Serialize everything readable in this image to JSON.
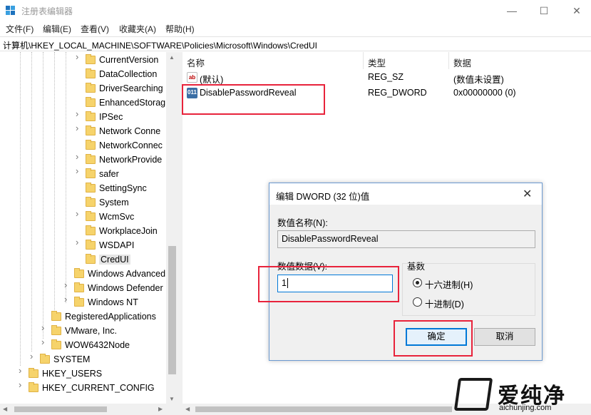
{
  "window": {
    "title": "注册表编辑器",
    "minimize": "—",
    "maximize": "☐",
    "close": "✕"
  },
  "menu": [
    "文件(F)",
    "编辑(E)",
    "查看(V)",
    "收藏夹(A)",
    "帮助(H)"
  ],
  "address": "计算机\\HKEY_LOCAL_MACHINE\\SOFTWARE\\Policies\\Microsoft\\Windows\\CredUI",
  "tree": [
    {
      "label": "CurrentVersion",
      "expandable": true
    },
    {
      "label": "DataCollection",
      "expandable": false
    },
    {
      "label": "DriverSearching",
      "expandable": false
    },
    {
      "label": "EnhancedStorag",
      "expandable": false
    },
    {
      "label": "IPSec",
      "expandable": true
    },
    {
      "label": "Network Conne",
      "expandable": true
    },
    {
      "label": "NetworkConnec",
      "expandable": false
    },
    {
      "label": "NetworkProvide",
      "expandable": true
    },
    {
      "label": "safer",
      "expandable": true
    },
    {
      "label": "SettingSync",
      "expandable": false
    },
    {
      "label": "System",
      "expandable": false
    },
    {
      "label": "WcmSvc",
      "expandable": true
    },
    {
      "label": "WorkplaceJoin",
      "expandable": false
    },
    {
      "label": "WSDAPI",
      "expandable": true
    },
    {
      "label": "CredUI",
      "expandable": false,
      "selected": true
    },
    {
      "label": "Windows Advanced",
      "expandable": false
    },
    {
      "label": "Windows Defender",
      "expandable": true
    },
    {
      "label": "Windows NT",
      "expandable": true
    },
    {
      "label": "RegisteredApplications",
      "expandable": false
    },
    {
      "label": "VMware, Inc.",
      "expandable": true
    },
    {
      "label": "WOW6432Node",
      "expandable": true
    },
    {
      "label": "SYSTEM",
      "expandable": true
    },
    {
      "label": "HKEY_USERS",
      "expandable": true
    },
    {
      "label": "HKEY_CURRENT_CONFIG",
      "expandable": true
    }
  ],
  "list": {
    "columns": [
      "名称",
      "类型",
      "数据"
    ],
    "rows": [
      {
        "icon": "ab",
        "name": "(默认)",
        "type": "REG_SZ",
        "data": "(数值未设置)"
      },
      {
        "icon": "011",
        "name": "DisablePasswordReveal",
        "type": "REG_DWORD",
        "data": "0x00000000 (0)"
      }
    ]
  },
  "dialog": {
    "title": "编辑 DWORD (32 位)值",
    "close": "✕",
    "name_label": "数值名称(N):",
    "name_value": "DisablePasswordReveal",
    "data_label": "数值数据(V):",
    "data_value": "1",
    "base_label": "基数",
    "hex_label": "十六进制(H)",
    "dec_label": "十进制(D)",
    "base_selected": "hex",
    "ok_label": "确定",
    "cancel_label": "取消"
  },
  "watermark": {
    "brand": "爱纯净",
    "url": "aichunjing.com"
  },
  "colors": {
    "highlight_box": "#e8233b",
    "accent": "#0078d7",
    "folder": "#f6d36b"
  }
}
